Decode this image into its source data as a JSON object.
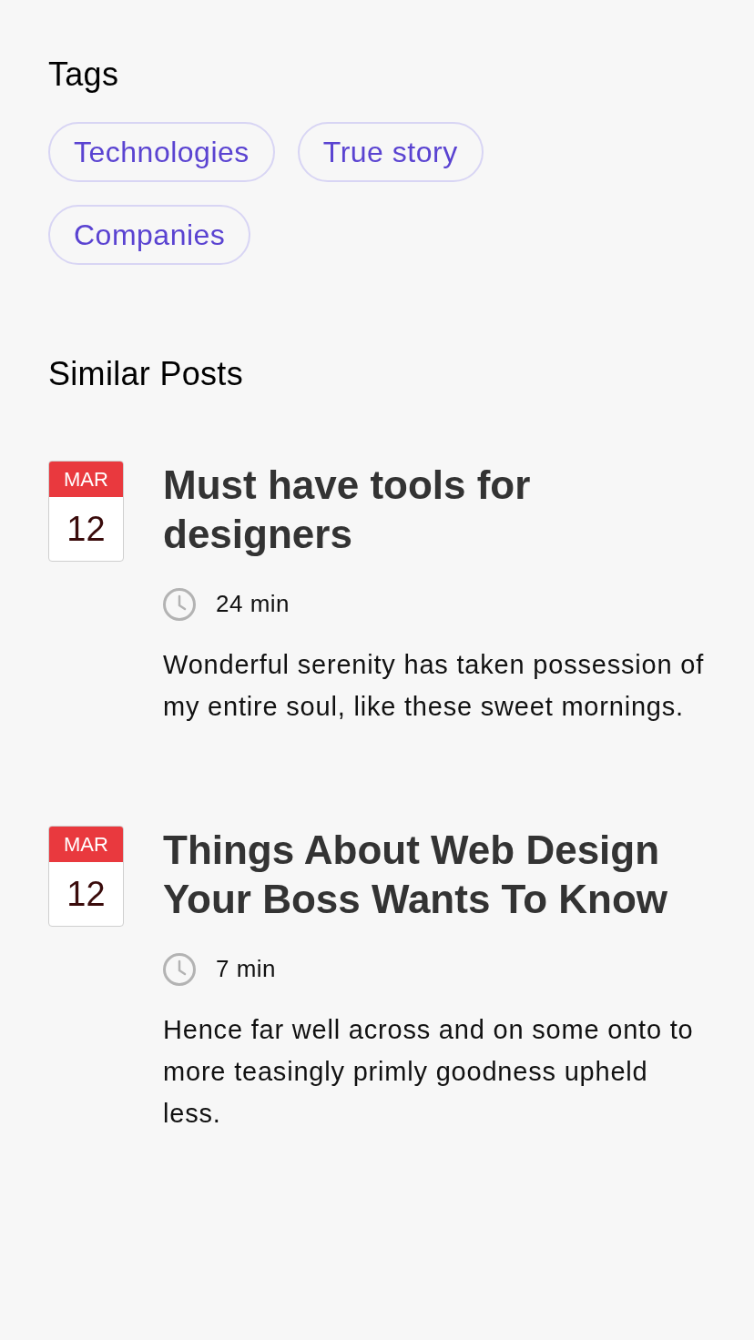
{
  "tags": {
    "title": "Tags",
    "items": [
      "Technologies",
      "True story",
      "Companies"
    ]
  },
  "similar_posts": {
    "title": "Similar Posts",
    "posts": [
      {
        "month": "MAR",
        "day": "12",
        "title": "Must have tools for designers",
        "read_time": "24 min",
        "excerpt": "Wonderful serenity has taken possession of my entire soul, like these sweet mornings."
      },
      {
        "month": "MAR",
        "day": "12",
        "title": "Things About Web Design Your Boss Wants To Know",
        "read_time": "7 min",
        "excerpt": "Hence far well across and on some onto to more teasingly primly goodness upheld less."
      }
    ]
  }
}
